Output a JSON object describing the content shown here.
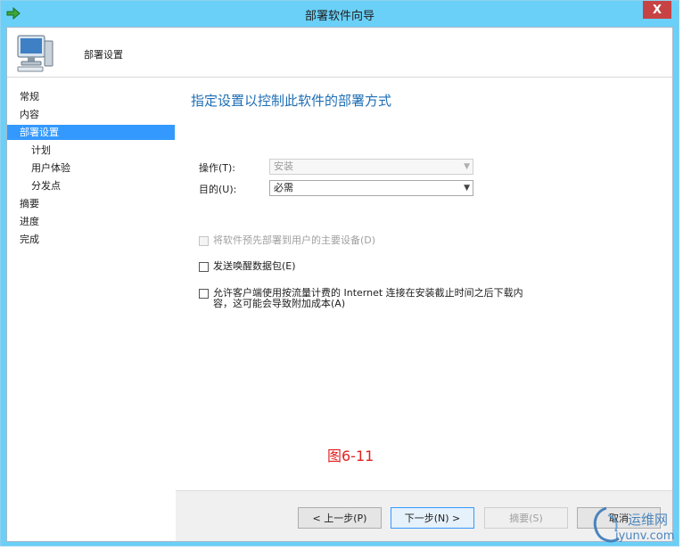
{
  "window": {
    "title": "部署软件向导",
    "close_label": "X"
  },
  "header": {
    "title": "部署设置"
  },
  "nav": {
    "items": [
      {
        "label": "常规"
      },
      {
        "label": "内容"
      },
      {
        "label": "部署设置"
      },
      {
        "label": "计划"
      },
      {
        "label": "用户体验"
      },
      {
        "label": "分发点"
      },
      {
        "label": "摘要"
      },
      {
        "label": "进度"
      },
      {
        "label": "完成"
      }
    ],
    "selected": "部署设置"
  },
  "main": {
    "title": "指定设置以控制此软件的部署方式",
    "action_label": "操作(T):",
    "action_value": "安装",
    "purpose_label": "目的(U):",
    "purpose_value": "必需",
    "predeploy_label": "将软件预先部署到用户的主要设备(D)",
    "wake_label": "发送唤醒数据包(E)",
    "metered_label_line1": "允许客户端使用按流量计费的 Internet 连接在安装截止时间之后下载内",
    "metered_label_line2": "容，这可能会导致附加成本(A)",
    "figure_caption": "图6-11"
  },
  "footer": {
    "prev_label": "< 上一步(P)",
    "next_label": "下一步(N) >",
    "summary_label": "摘要(S)",
    "cancel_label": "取消"
  },
  "watermark": {
    "line1": "运维网",
    "line2": "iyunv.com"
  },
  "colors": {
    "titlebar": "#6ad0f8",
    "selection": "#3399ff",
    "heading": "#1e6eb4",
    "caption": "#e02020",
    "close": "#c74343"
  }
}
